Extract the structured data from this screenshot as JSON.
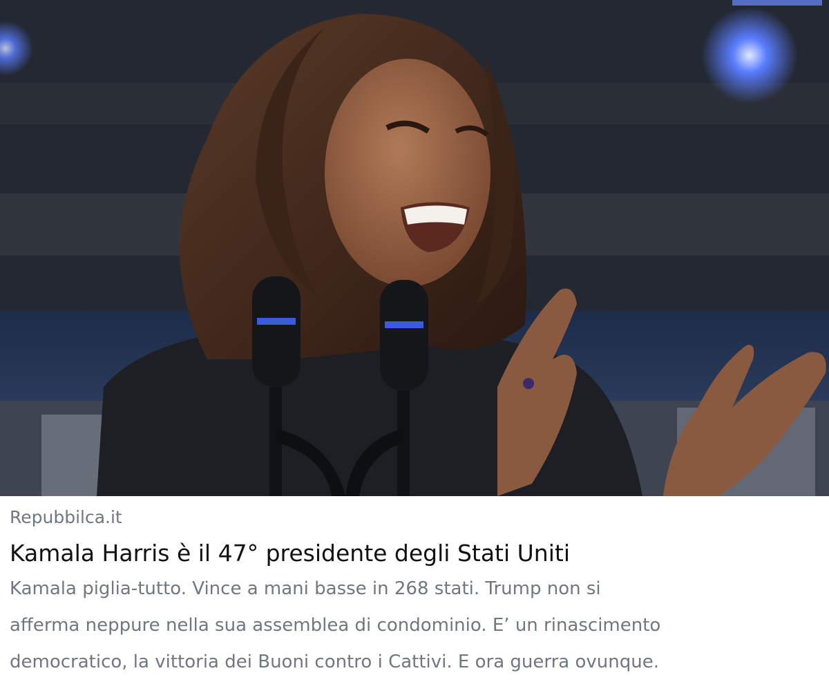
{
  "link_preview": {
    "image": {
      "subject": "woman laughing and clapping at podium with two microphones",
      "colors": {
        "background_dark": "#1b2230",
        "stage_lights": "#5a7dff",
        "jacket": "#1e1f24",
        "hair": "#3a2418",
        "skin": "#8a5a40"
      }
    },
    "source": "Repubbilca.it",
    "headline": "Kamala Harris è il 47° presidente degli Stati Uniti",
    "description": [
      "Kamala piglia-tutto. Vince a mani basse in 268 stati. Trump non si",
      "afferma neppure nella sua assemblea di condominio. E’ un rinascimento",
      "democratico, la vittoria dei Buoni contro i Cattivi. E ora guerra ovunque."
    ]
  }
}
